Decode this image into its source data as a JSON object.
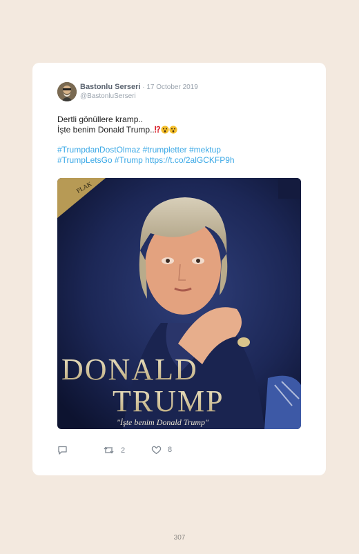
{
  "tweet": {
    "author_name": "Bastonlu Serseri",
    "separator": " · ",
    "date": "17 October 2019",
    "handle": "@BastonluSerseri",
    "text_line1": "Dertli gönüllere kramp..",
    "text_line2": "İşte benim Donald Trump..",
    "text_emphasis": "⁉",
    "emoji": [
      "astonished-face-emoji",
      "astonished-face-emoji"
    ],
    "hashtag_line1": "#TrumpdanDostOlmaz #trumpletter #mektup",
    "hashtag_line2": "#TrumpLetsGo #Trump https://t.co/2alGCKFP9h",
    "media": {
      "title_line1": "DONALD",
      "title_line2": "TRUMP",
      "caption": "\"İşte benim Donald Trump\"",
      "corner_label": "PLAK"
    }
  },
  "actions": {
    "reply_icon": "reply-icon",
    "retweet_icon": "retweet-icon",
    "retweet_count": "2",
    "like_icon": "heart-icon",
    "like_count": "8"
  },
  "page": {
    "number": "307"
  },
  "colors": {
    "background": "#f3e9df",
    "card": "#ffffff",
    "link": "#3aa8e6",
    "muted": "#9aa3ad"
  }
}
